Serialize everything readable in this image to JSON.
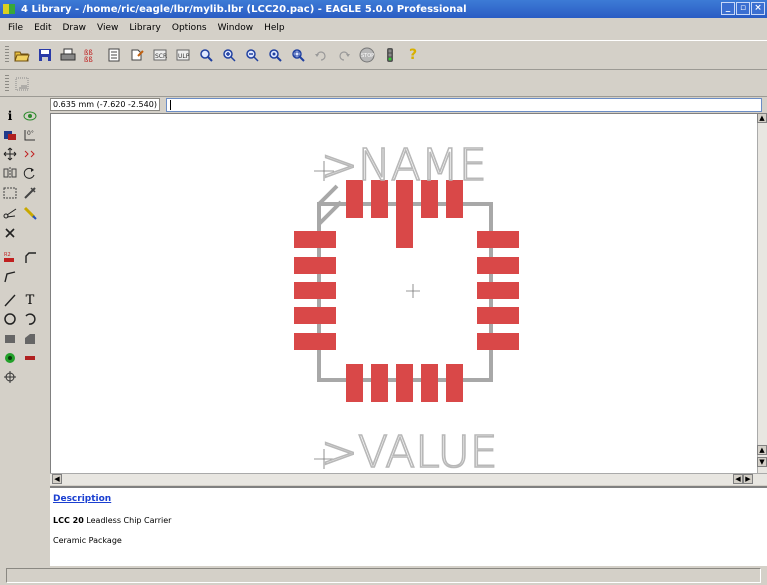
{
  "window": {
    "title": "4 Library - /home/ric/eagle/lbr/mylib.lbr (LCC20.pac) - EAGLE 5.0.0 Professional",
    "buttons": [
      "_",
      "▫",
      "×"
    ]
  },
  "menu": [
    "File",
    "Edit",
    "Draw",
    "View",
    "Library",
    "Options",
    "Window",
    "Help"
  ],
  "toolbar": {
    "icons": [
      "open-icon",
      "save-icon",
      "print-icon",
      "cam-icon",
      "bom-icon",
      "script-icon",
      "ulp-icon",
      "ulp2-icon",
      "zoom-fit-icon",
      "zoom-in-icon",
      "zoom-out-icon",
      "zoom-redraw-icon",
      "zoom-select-icon",
      "undo-icon",
      "redo-icon",
      "stop-icon",
      "go-icon",
      "help-icon"
    ]
  },
  "coordinates": {
    "readout": "0.635 mm (-7.620 -2.540)",
    "command_value": ""
  },
  "canvas": {
    "name_label": ">NAME",
    "value_label": ">VALUE",
    "pad_color": "#d94848",
    "outline_color": "#a8a8a8"
  },
  "description": {
    "link": "Description",
    "part": "LCC 20",
    "part_desc": " Leadless Chip Carrier",
    "package": "Ceramic Package"
  },
  "status": {
    "text": ""
  }
}
